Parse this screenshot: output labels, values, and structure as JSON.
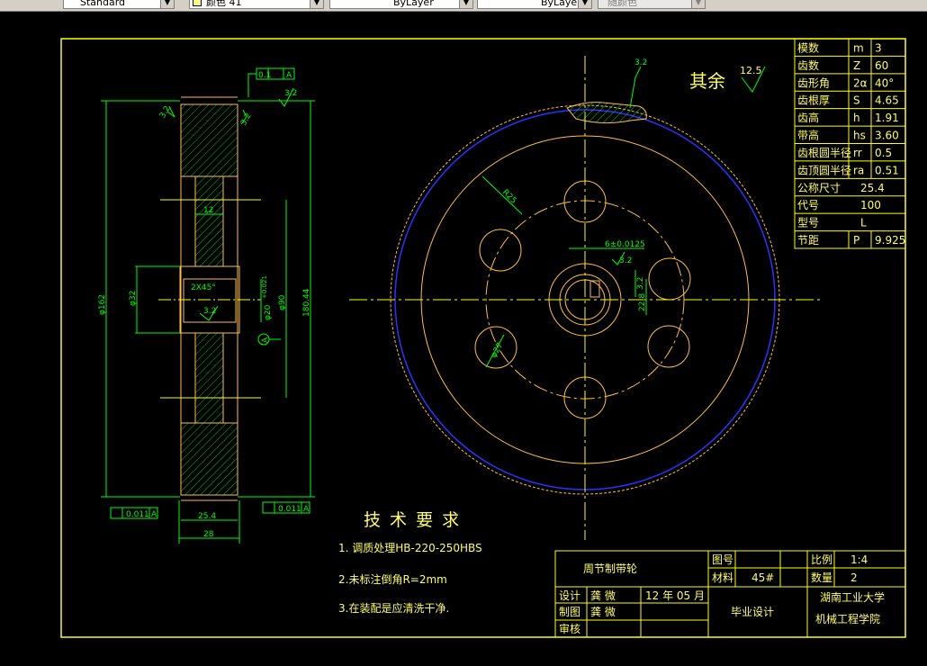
{
  "toolbar": {
    "style_value": "Standard",
    "color_value": "颜色 41",
    "linetype_value": "ByLayer",
    "lineweight_value": "ByLayer",
    "plotstyle_value": "随颜色",
    "color_swatch": "#ffff80"
  },
  "colors": {
    "background": "#000000",
    "frame": "#ffff00",
    "part": "#ffc040",
    "dimension": "#00ff00",
    "blue_circle": "#3030ff",
    "text": "#ffff60"
  },
  "side_view": {
    "tolerance_top": "0.1",
    "tolerance_top_datum": "A",
    "rough_top": "3.2",
    "rough_left": "3.2",
    "rough_right": "3.2",
    "dim_12": "12",
    "chamfer": "2X45°",
    "rough_bore": "3.2",
    "dim_bore": "φ20",
    "dim_bore_tol": "+0.021",
    "dim_bore_tol2": "0",
    "dim_hub": "φ32",
    "dim_outer": "φ162",
    "dim_90": "φ90",
    "dim_180": "180.44",
    "datum": "A",
    "tol_left": "0.011",
    "tol_left_datum": "A",
    "tol_right": "0.011",
    "tol_right_datum": "A",
    "dim_25_4": "25.4",
    "dim_28": "28"
  },
  "front_view": {
    "rough_top": "3.2",
    "rest_rough_label": "其余",
    "rest_rough_value": "12.5",
    "r_label": "R25",
    "key_tol": "6±0.0125",
    "key_rough": "3.2",
    "key_dim1": "3.2",
    "key_dim2": "22.8",
    "hole_label": "φ27"
  },
  "params_table": [
    {
      "label": "模数",
      "symbol": "m",
      "value": "3"
    },
    {
      "label": "齿数",
      "symbol": "Z",
      "value": "60"
    },
    {
      "label": "齿形角",
      "symbol": "2α",
      "value": "40°"
    },
    {
      "label": "齿根厚",
      "symbol": "S",
      "value": "4.65"
    },
    {
      "label": "齿高",
      "symbol": "h",
      "value": "1.91"
    },
    {
      "label": "带高",
      "symbol": "hs",
      "value": "3.60"
    },
    {
      "label": "齿根圆半径",
      "symbol": "rr",
      "value": "0.5"
    },
    {
      "label": "齿顶圆半径",
      "symbol": "ra",
      "value": "0.51"
    },
    {
      "label": "公称尺寸",
      "symbol": "",
      "value": "25.4"
    },
    {
      "label": "代号",
      "symbol": "",
      "value": "100"
    },
    {
      "label": "型号",
      "symbol": "",
      "value": "L"
    },
    {
      "label": "节距",
      "symbol": "P",
      "value": "9.925"
    }
  ],
  "tech_requirements": {
    "title": "技 术 要 求",
    "items": [
      "1. 调质处理HB-220-250HBS",
      "2.未标注倒角R=2mm",
      "3.在装配是应清洗干净."
    ]
  },
  "title_block": {
    "part_name": "周节制带轮",
    "drawing_no_label": "图号",
    "drawing_no": "",
    "material_label": "材料",
    "material": "45#",
    "scale_label": "比例",
    "scale": "1:4",
    "qty_label": "数量",
    "qty": "2",
    "design_label": "设计",
    "designer": "龚 微",
    "date": "12 年 05 月",
    "draw_label": "制图",
    "drawer": "龚 微",
    "review_label": "审核",
    "reviewer": "",
    "project": "毕业设计",
    "school1": "湖南工业大学",
    "school2": "机械工程学院"
  }
}
